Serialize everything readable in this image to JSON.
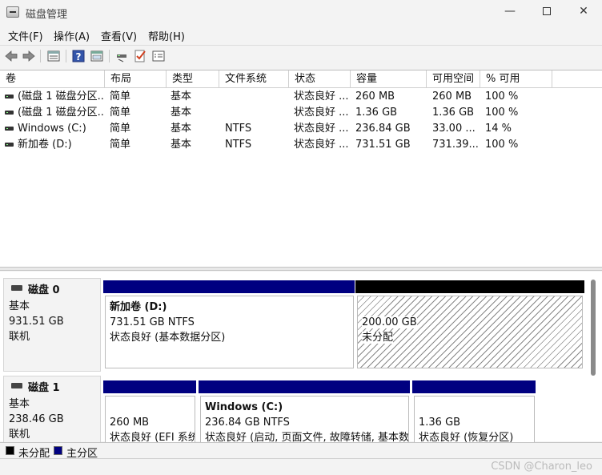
{
  "window": {
    "title": "磁盘管理",
    "min_glyph": "—",
    "close_glyph": "✕"
  },
  "menu": [
    "文件(F)",
    "操作(A)",
    "查看(V)",
    "帮助(H)"
  ],
  "toolbar": {
    "icons": [
      "back-arrow-icon",
      "forward-arrow-icon",
      "volume-list-icon",
      "help-icon",
      "graphical-view-icon",
      "connect-icon",
      "check-icon",
      "properties-icon"
    ]
  },
  "volume_table": {
    "columns": [
      "卷",
      "布局",
      "类型",
      "文件系统",
      "状态",
      "容量",
      "可用空间",
      "% 可用"
    ],
    "rows": [
      [
        "(磁盘 1 磁盘分区...",
        "简单",
        "基本",
        "",
        "状态良好 ...",
        "260 MB",
        "260 MB",
        "100 %"
      ],
      [
        "(磁盘 1 磁盘分区...",
        "简单",
        "基本",
        "",
        "状态良好 ...",
        "1.36 GB",
        "1.36 GB",
        "100 %"
      ],
      [
        "Windows (C:)",
        "简单",
        "基本",
        "NTFS",
        "状态良好 ...",
        "236.84 GB",
        "33.00 ...",
        "14 %"
      ],
      [
        "新加卷 (D:)",
        "简单",
        "基本",
        "NTFS",
        "状态良好 ...",
        "731.51 GB",
        "731.39...",
        "100 %"
      ]
    ]
  },
  "disks": [
    {
      "name": "磁盘 0",
      "type": "基本",
      "size": "931.51 GB",
      "status": "联机",
      "partitions": [
        {
          "title": "新加卷  (D:)",
          "size_fs": "731.51 GB NTFS",
          "status": "状态良好 (基本数据分区)",
          "kind": "primary"
        },
        {
          "title": "",
          "size_fs": "200.00 GB",
          "status": "未分配",
          "kind": "unallocated"
        }
      ]
    },
    {
      "name": "磁盘 1",
      "type": "基本",
      "size": "238.46 GB",
      "status": "联机",
      "partitions": [
        {
          "title": "",
          "size_fs": "260 MB",
          "status": "状态良好 (EFI 系统",
          "kind": "primary"
        },
        {
          "title": "Windows  (C:)",
          "size_fs": "236.84 GB NTFS",
          "status": "状态良好 (启动, 页面文件, 故障转储, 基本数",
          "kind": "primary"
        },
        {
          "title": "",
          "size_fs": "1.36 GB",
          "status": "状态良好 (恢复分区)",
          "kind": "primary"
        }
      ]
    }
  ],
  "legend": {
    "unallocated_label": "未分配",
    "primary_label": "主分区",
    "unallocated_color": "#000000",
    "primary_color": "#000080"
  },
  "watermark": "CSDN @Charon_leo"
}
